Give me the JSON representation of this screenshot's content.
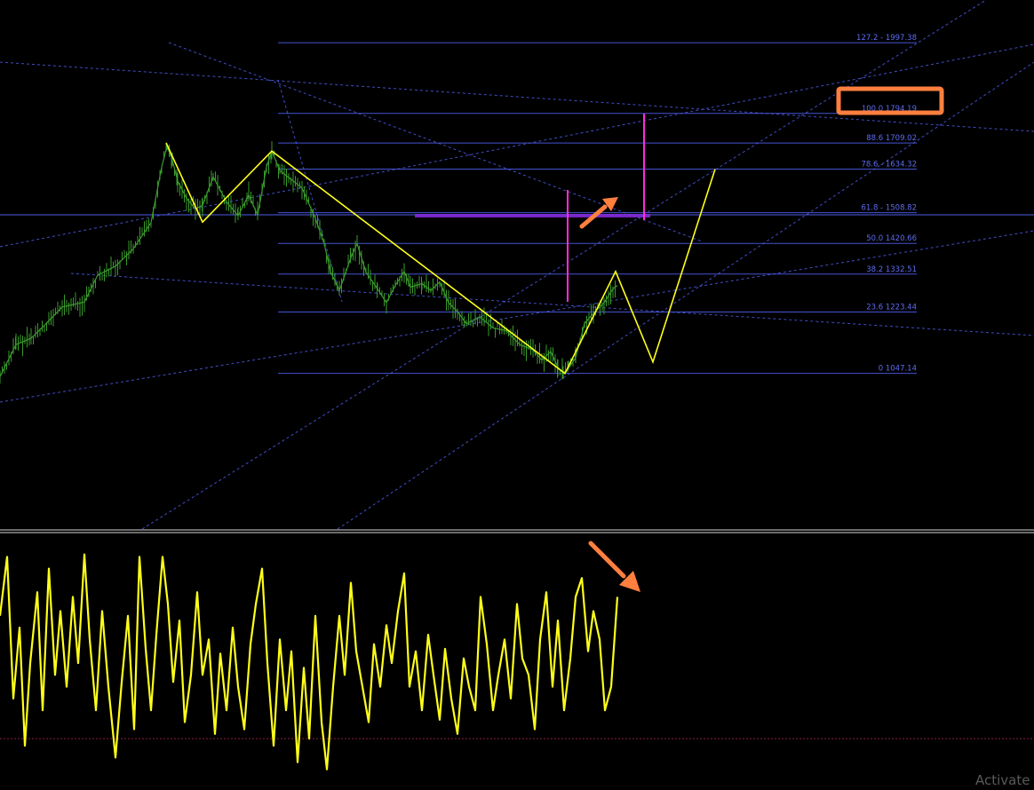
{
  "chart_data": [
    {
      "type": "line",
      "panel": "price",
      "series": [
        {
          "x": [
            0,
            18,
            35,
            50,
            70,
            95,
            110,
            130,
            150,
            170,
            182,
            188,
            194,
            200,
            210,
            220,
            228,
            240,
            255,
            268,
            280,
            290,
            300,
            306,
            315,
            325,
            340,
            355,
            365,
            372,
            382,
            395,
            402,
            412,
            425,
            435,
            445,
            455,
            462,
            475,
            485,
            495,
            505,
            515,
            525,
            540,
            555,
            570,
            585,
            600,
            610,
            620,
            628,
            634,
            640,
            648,
            658,
            668,
            680,
            690,
            695
          ],
          "y": [
            1038,
            1130,
            1148,
            1185,
            1238,
            1252,
            1330,
            1355,
            1405,
            1480,
            1640,
            1700,
            1660,
            1600,
            1550,
            1520,
            1530,
            1612,
            1540,
            1500,
            1560,
            1502,
            1640,
            1686,
            1630,
            1610,
            1580,
            1492,
            1420,
            1340,
            1285,
            1380,
            1420,
            1338,
            1290,
            1250,
            1300,
            1340,
            1295,
            1305,
            1285,
            1310,
            1250,
            1225,
            1190,
            1210,
            1178,
            1170,
            1130,
            1115,
            1085,
            1110,
            1065,
            1048,
            1062,
            1092,
            1190,
            1220,
            1250,
            1290,
            1300
          ]
        },
        {
          "x": [
            187,
            228,
            306,
            636,
            693,
            735,
            805
          ],
          "y": [
            1710,
            1482,
            1686,
            1047,
            1340,
            1080,
            1634
          ]
        }
      ]
    },
    {
      "type": "line",
      "panel": "oscillator",
      "series": [
        {
          "x": [
            0,
            8,
            15,
            22,
            28,
            34,
            42,
            48,
            55,
            62,
            68,
            75,
            82,
            88,
            95,
            101,
            108,
            115,
            122,
            130,
            137,
            144,
            151,
            157,
            164,
            170,
            176,
            183,
            189,
            195,
            202,
            208,
            215,
            222,
            228,
            235,
            242,
            248,
            255,
            262,
            268,
            275,
            282,
            288,
            295,
            301,
            308,
            315,
            322,
            328,
            335,
            342,
            348,
            355,
            362,
            368,
            375,
            382,
            388,
            395,
            401,
            408,
            415,
            421,
            428,
            435,
            441,
            448,
            455,
            461,
            468,
            475,
            482,
            488,
            495,
            501,
            508,
            515,
            522,
            528,
            535,
            541,
            548,
            555,
            561,
            568,
            575,
            582,
            588,
            595,
            602,
            608,
            615,
            622,
            628,
            635,
            642,
            648,
            655,
            662,
            668,
            675,
            681,
            688,
            695
          ],
          "y": [
            70,
            95,
            35,
            65,
            15,
            50,
            80,
            30,
            90,
            45,
            72,
            40,
            78,
            50,
            96,
            60,
            30,
            72,
            40,
            10,
            42,
            70,
            22,
            95,
            56,
            30,
            62,
            95,
            75,
            42,
            68,
            25,
            45,
            80,
            45,
            60,
            20,
            54,
            30,
            65,
            40,
            22,
            58,
            75,
            90,
            50,
            15,
            60,
            30,
            55,
            8,
            48,
            18,
            70,
            25,
            5,
            40,
            70,
            45,
            84,
            55,
            40,
            25,
            58,
            40,
            66,
            50,
            72,
            88,
            40,
            55,
            30,
            62,
            45,
            26,
            56,
            35,
            20,
            52,
            40,
            30,
            78,
            58,
            30,
            45,
            60,
            35,
            75,
            52,
            45,
            22,
            60,
            80,
            40,
            68,
            30,
            52,
            78,
            86,
            55,
            72,
            60,
            30,
            40,
            78
          ]
        }
      ]
    }
  ],
  "price_axis": {
    "min": 600,
    "max": 2120
  },
  "oscillator_axis": {
    "min": 0,
    "max": 100,
    "level": 18
  },
  "fib_levels": [
    {
      "label": "127.2 - 1997.38",
      "value": 1997.38
    },
    {
      "label": "100.0 1794.19",
      "value": 1794.19
    },
    {
      "label": "88.6 1709.02",
      "value": 1709.02
    },
    {
      "label": "78.6 - 1634.32",
      "value": 1634.32
    },
    {
      "label": "61.8 - 1508.82",
      "value": 1508.82
    },
    {
      "label": "50.0 1420.66",
      "value": 1420.66
    },
    {
      "label": "38.2 1332.51",
      "value": 1332.51
    },
    {
      "label": "23.6 1223.44",
      "value": 1223.44
    },
    {
      "label": "0 1047.14",
      "value": 1047.14
    }
  ],
  "colors": {
    "background": "#000000",
    "candles": "#3a9a2c",
    "pattern": "#ffff1a",
    "fib": "#4c5ce8",
    "trend": "#4c5ce8",
    "magenta": "#ff2ddc",
    "orange": "#ff7f3f",
    "oscillator": "#ffff1a",
    "divider": "#d8d8d8",
    "level_line": "#8a1e4a"
  },
  "overlay_text": {
    "watermark": "Activate"
  }
}
